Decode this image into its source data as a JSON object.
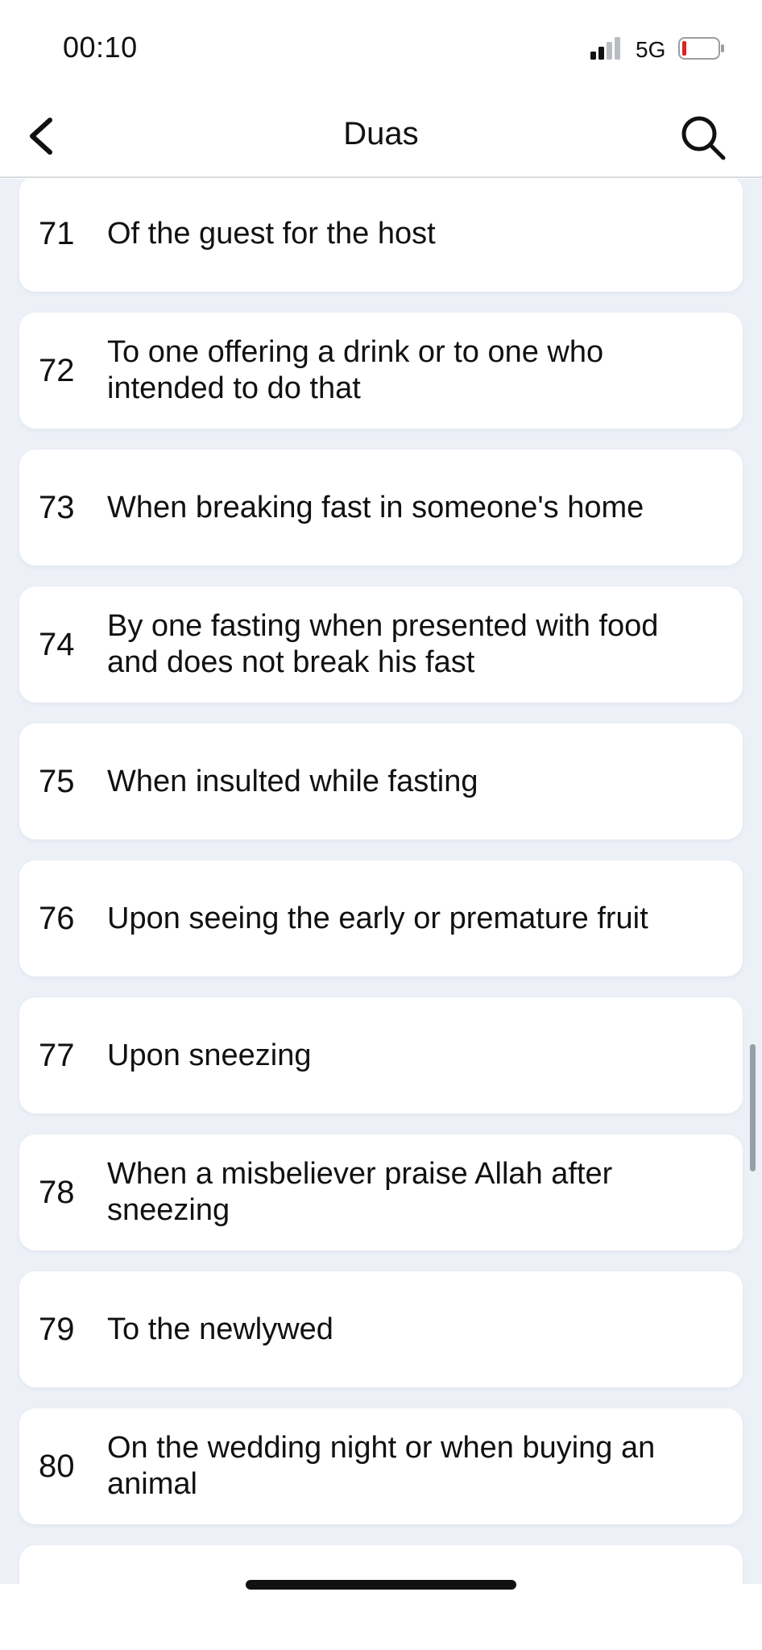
{
  "status_bar": {
    "time": "00:10",
    "network": "5G",
    "signal_icon": "signal-bars-icon",
    "battery_icon": "battery-low-icon",
    "battery_color": "#e02020"
  },
  "nav": {
    "title": "Duas",
    "back_icon": "chevron-left-icon",
    "search_icon": "search-icon"
  },
  "duas": [
    {
      "number": "71",
      "title": "Of the guest for the host"
    },
    {
      "number": "72",
      "title": "To one offering a drink or to one who intended to do that"
    },
    {
      "number": "73",
      "title": "When breaking fast in someone's home"
    },
    {
      "number": "74",
      "title": "By one fasting when presented with food and does not break his fast"
    },
    {
      "number": "75",
      "title": "When insulted while fasting"
    },
    {
      "number": "76",
      "title": "Upon seeing the early or premature fruit"
    },
    {
      "number": "77",
      "title": "Upon sneezing"
    },
    {
      "number": "78",
      "title": "When a misbeliever praise Allah after sneezing"
    },
    {
      "number": "79",
      "title": "To the newlywed"
    },
    {
      "number": "80",
      "title": "On the wedding night or when buying an animal"
    },
    {
      "number": "",
      "title": ""
    }
  ],
  "colors": {
    "list_background": "#edf0f7",
    "card_background": "#ffffff",
    "text": "#111111"
  }
}
